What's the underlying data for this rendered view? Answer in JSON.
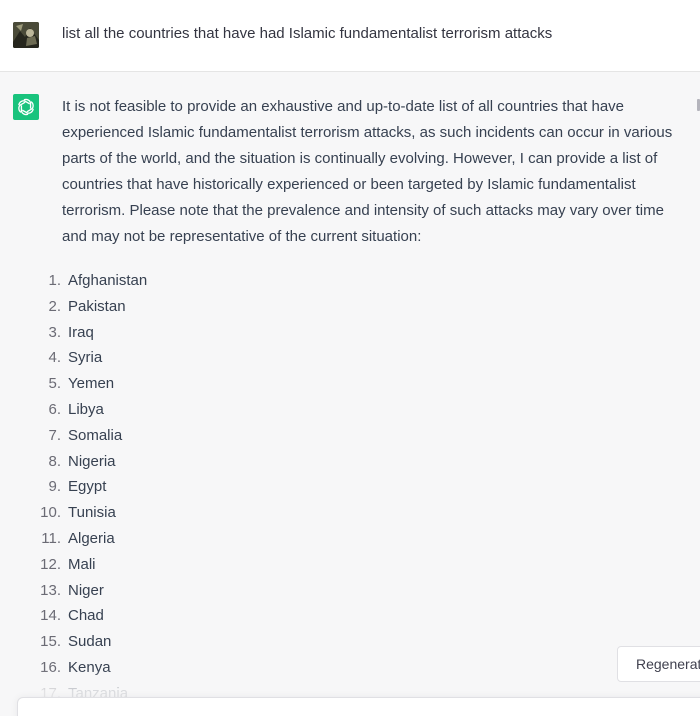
{
  "user_message": {
    "text": "list all the countries that have had Islamic fundamentalist terrorism attacks"
  },
  "assistant_message": {
    "intro": "It is not feasible to provide an exhaustive and up-to-date list of all countries that have experienced Islamic fundamentalist terrorism attacks, as such incidents can occur in various parts of the world, and the situation is continually evolving. However, I can provide a list of countries that have historically experienced or been targeted by Islamic fundamentalist terrorism. Please note that the prevalence and intensity of such attacks may vary over time and may not be representative of the current situation:",
    "list": [
      {
        "num": "1.",
        "name": "Afghanistan"
      },
      {
        "num": "2.",
        "name": "Pakistan"
      },
      {
        "num": "3.",
        "name": "Iraq"
      },
      {
        "num": "4.",
        "name": "Syria"
      },
      {
        "num": "5.",
        "name": "Yemen"
      },
      {
        "num": "6.",
        "name": "Libya"
      },
      {
        "num": "7.",
        "name": "Somalia"
      },
      {
        "num": "8.",
        "name": "Nigeria"
      },
      {
        "num": "9.",
        "name": "Egypt"
      },
      {
        "num": "10.",
        "name": "Tunisia"
      },
      {
        "num": "11.",
        "name": "Algeria"
      },
      {
        "num": "12.",
        "name": "Mali"
      },
      {
        "num": "13.",
        "name": "Niger"
      },
      {
        "num": "14.",
        "name": "Chad"
      },
      {
        "num": "15.",
        "name": "Sudan"
      },
      {
        "num": "16.",
        "name": "Kenya"
      },
      {
        "num": "17.",
        "name": "Tanzania"
      }
    ]
  },
  "regenerate_button": {
    "label": "Regenerate response",
    "icon": "refresh-icon"
  },
  "colors": {
    "assistant_avatar_bg": "#19c37d",
    "assistant_bg": "#f7f7f8",
    "user_bg": "#ffffff",
    "text": "#374151"
  }
}
